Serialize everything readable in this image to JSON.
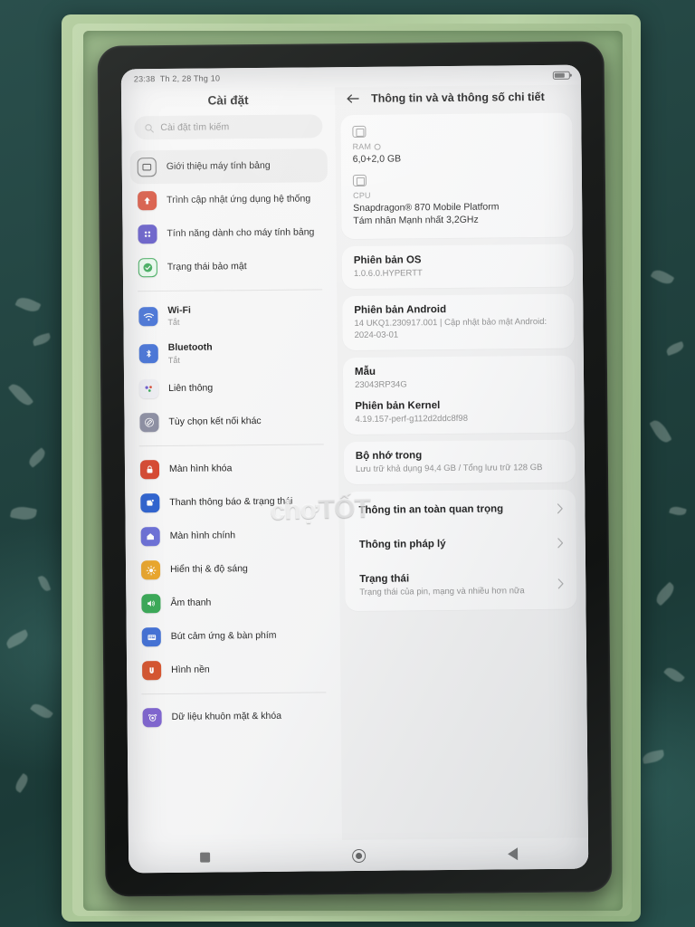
{
  "status_bar": {
    "time": "23:38",
    "date": "Th 2, 28 Thg 10",
    "battery_icon": "battery-icon"
  },
  "watermark": {
    "first": "chợ",
    "second": "TỐT"
  },
  "sidebar": {
    "title": "Cài đặt",
    "search": {
      "placeholder": "Cài đặt tìm kiếm",
      "icon": "search-icon"
    },
    "items": [
      {
        "label": "Giới thiệu máy tính bảng",
        "sub": "",
        "icon": "tablet-icon",
        "selected": true
      },
      {
        "label": "Trình cập nhật ứng dụng hệ thống",
        "sub": "",
        "icon": "system-update-icon",
        "selected": false
      },
      {
        "label": "Tính năng dành cho máy tính bảng",
        "sub": "",
        "icon": "tablet-features-icon",
        "selected": false
      },
      {
        "label": "Trạng thái bảo mật",
        "sub": "",
        "icon": "security-shield-icon",
        "selected": false
      },
      {
        "label": "Wi-Fi",
        "sub": "Tắt",
        "icon": "wifi-icon",
        "selected": false,
        "bold": true,
        "divider_before": true
      },
      {
        "label": "Bluetooth",
        "sub": "Tắt",
        "icon": "bluetooth-icon",
        "selected": false,
        "bold": true
      },
      {
        "label": "Liên thông",
        "sub": "",
        "icon": "interconnect-icon",
        "selected": false
      },
      {
        "label": "Tùy chọn kết nối khác",
        "sub": "",
        "icon": "more-connections-icon",
        "selected": false
      },
      {
        "label": "Màn hình khóa",
        "sub": "",
        "icon": "lock-screen-icon",
        "selected": false,
        "divider_before": true
      },
      {
        "label": "Thanh thông báo & trạng thái",
        "sub": "",
        "icon": "notification-bar-icon",
        "selected": false
      },
      {
        "label": "Màn hình chính",
        "sub": "",
        "icon": "home-screen-icon",
        "selected": false
      },
      {
        "label": "Hiển thị & độ sáng",
        "sub": "",
        "icon": "display-brightness-icon",
        "selected": false
      },
      {
        "label": "Âm thanh",
        "sub": "",
        "icon": "sound-icon",
        "selected": false
      },
      {
        "label": "Bút cảm ứng & bàn phím",
        "sub": "",
        "icon": "stylus-keyboard-icon",
        "selected": false
      },
      {
        "label": "Hình nền",
        "sub": "",
        "icon": "wallpaper-icon",
        "selected": false
      },
      {
        "label": "Dữ liệu khuôn mặt & khóa",
        "sub": "",
        "icon": "face-data-icon",
        "selected": false,
        "divider_before": true
      }
    ]
  },
  "detail": {
    "back_icon": "back-arrow-icon",
    "title": "Thông tin và và thông số chi tiết",
    "specs": [
      {
        "icon": "chip-icon",
        "key": "RAM",
        "has_info": true,
        "value": "6,0+2,0 GB"
      },
      {
        "icon": "chip-icon",
        "key": "CPU",
        "has_info": false,
        "value": "Snapdragon® 870 Mobile Platform\nTám nhân Mạnh nhất 3,2GHz"
      }
    ],
    "cards": [
      {
        "title": "Phiên bản OS",
        "sub": "1.0.6.0.HYPERTT"
      },
      {
        "title": "Phiên bản Android",
        "sub": "14 UKQ1.230917.001 | Cập nhật bảo mật Android: 2024-03-01"
      }
    ],
    "pairs_card": [
      {
        "title": "Mẫu",
        "sub": "23043RP34G"
      },
      {
        "title": "Phiên bản Kernel",
        "sub": "4.19.157-perf-g112d2ddc8f98"
      }
    ],
    "storage": {
      "title": "Bộ nhớ trong",
      "sub": "Lưu trữ khả dụng  94,4 GB / Tổng lưu trữ  128 GB"
    },
    "nav_items": [
      {
        "title": "Thông tin an toàn quan trọng",
        "sub": "",
        "chevron": "chevron-right-icon"
      },
      {
        "title": "Thông tin pháp lý",
        "sub": "",
        "chevron": "chevron-right-icon"
      },
      {
        "title": "Trạng thái",
        "sub": "Trạng thái của pin, mạng và nhiều hơn nữa",
        "chevron": "chevron-right-icon"
      }
    ]
  },
  "navbar": {
    "recents": "square-recents-icon",
    "home": "circle-home-icon",
    "back": "triangle-back-icon"
  },
  "colors": {
    "accent_blue": "#3b6fe0",
    "red": "#e2452b",
    "green": "#2fab4f",
    "purple": "#6a55d6",
    "orange": "#f0a51e"
  }
}
